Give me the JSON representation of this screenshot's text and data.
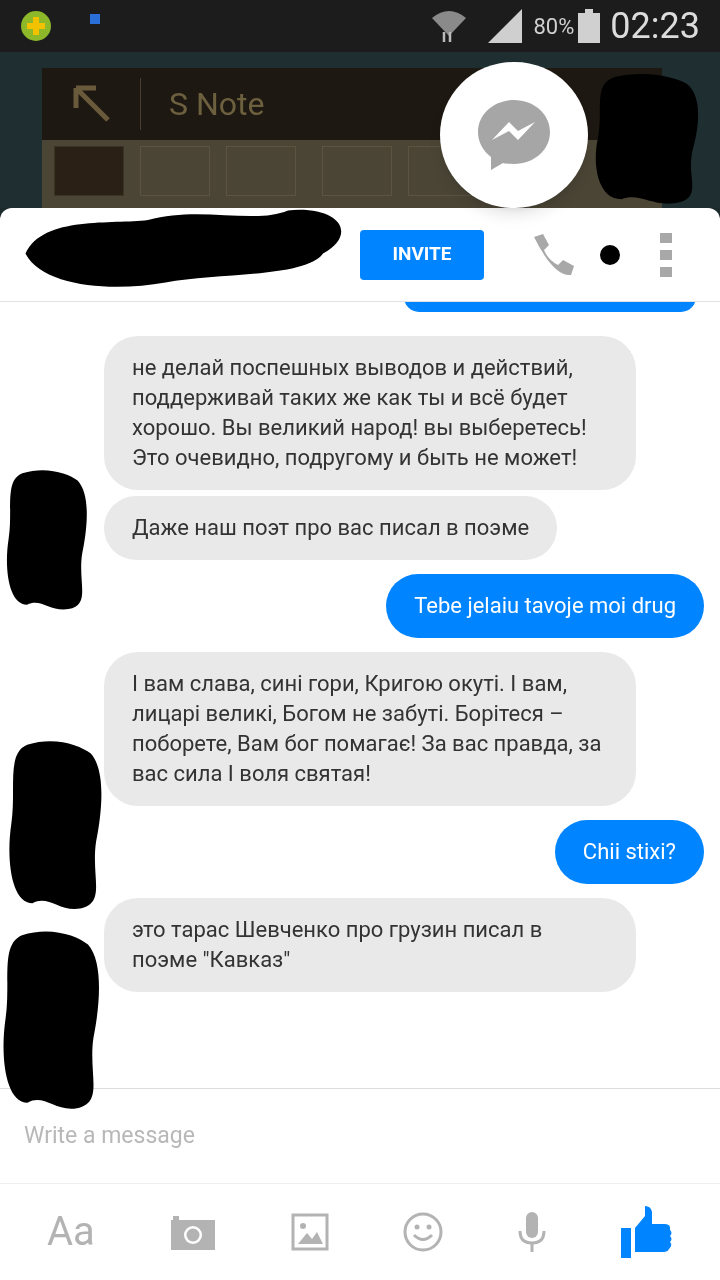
{
  "status_bar": {
    "battery": "80%",
    "time": "02:23"
  },
  "background_app": {
    "title": "S Note"
  },
  "header": {
    "invite_button": "INVITE"
  },
  "messages": [
    {
      "kind": "incoming",
      "text": "не делай поспешных выводов и действий, поддерживай таких же как ты и всё будет хорошо. Вы великий народ! вы выберетесь! Это очевидно, подругому и быть не может!"
    },
    {
      "kind": "incoming",
      "text": "Даже наш поэт про вас писал в поэме"
    },
    {
      "kind": "outgoing",
      "text": "Tebe jelaiu tavoje moi drug"
    },
    {
      "kind": "incoming",
      "text": "І вам слава, сині гори, Кригою окуті. І вам, лицарі великі, Богом не забуті. Борітеся – поборете, Вам бог помагає! За вас правда, за вас сила І воля святая!"
    },
    {
      "kind": "outgoing",
      "text": "Chii stixi?"
    },
    {
      "kind": "incoming",
      "text": "это тарас Шевченко про грузин писал в поэме \"Кавказ\""
    }
  ],
  "composer": {
    "placeholder": "Write a message"
  },
  "toolbar": [
    {
      "kind": "text",
      "label": "Aa"
    },
    {
      "kind": "camera"
    },
    {
      "kind": "gallery"
    },
    {
      "kind": "emoji"
    },
    {
      "kind": "microphone"
    },
    {
      "kind": "like"
    }
  ]
}
